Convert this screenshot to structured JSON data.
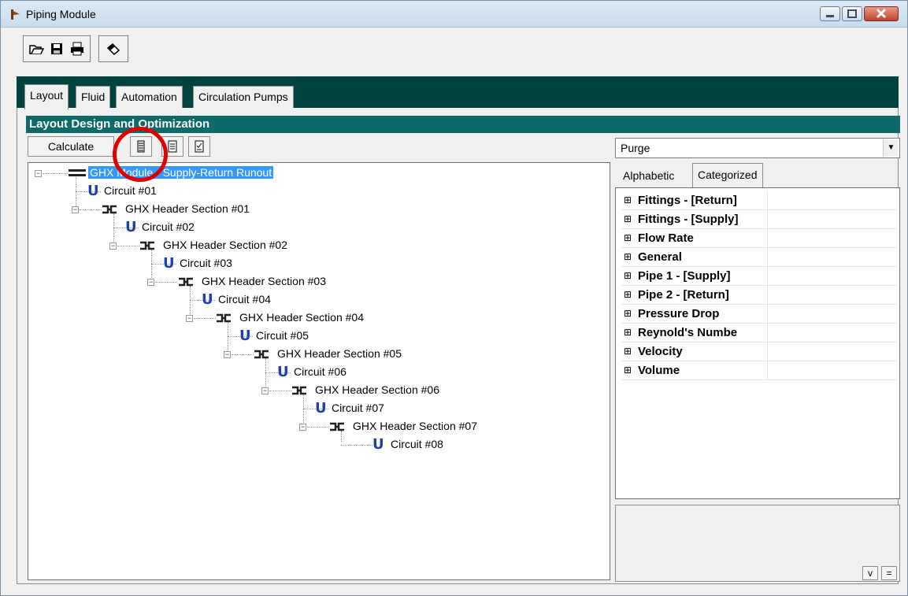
{
  "window": {
    "title": "Piping Module"
  },
  "tabs": [
    "Layout",
    "Fluid",
    "Automation",
    "Circulation Pumps"
  ],
  "section_header": "Layout Design and Optimization",
  "calculate_label": "Calculate",
  "tree": [
    {
      "label": "GHX Module - Supply-Return Runout",
      "icon": "manifold-icon",
      "selected": true
    },
    {
      "label": "Circuit #01",
      "icon": "u-loop-icon"
    },
    {
      "label": "GHX Header Section #01",
      "icon": "header-icon"
    },
    {
      "label": "Circuit #02",
      "icon": "u-loop-icon"
    },
    {
      "label": "GHX Header Section #02",
      "icon": "header-icon"
    },
    {
      "label": "Circuit #03",
      "icon": "u-loop-icon"
    },
    {
      "label": "GHX Header Section #03",
      "icon": "header-icon"
    },
    {
      "label": "Circuit #04",
      "icon": "u-loop-icon"
    },
    {
      "label": "GHX Header Section #04",
      "icon": "header-icon"
    },
    {
      "label": "Circuit #05",
      "icon": "u-loop-icon"
    },
    {
      "label": "GHX Header Section #05",
      "icon": "header-icon"
    },
    {
      "label": "Circuit #06",
      "icon": "u-loop-icon"
    },
    {
      "label": "GHX Header Section #06",
      "icon": "header-icon"
    },
    {
      "label": "Circuit #07",
      "icon": "u-loop-icon"
    },
    {
      "label": "GHX Header Section #07",
      "icon": "header-icon"
    },
    {
      "label": "Circuit #08",
      "icon": "u-loop-icon"
    }
  ],
  "property_combo": {
    "value": "Purge"
  },
  "property_tabs": [
    "Alphabetic",
    "Categorized"
  ],
  "categories": [
    "Fittings - [Return]",
    "Fittings - [Supply]",
    "Flow Rate",
    "General",
    "Pipe 1 - [Supply]",
    "Pipe 2 - [Return]",
    "Pressure Drop",
    "Reynold's Numbe",
    "Velocity",
    "Volume"
  ],
  "desc_buttons": [
    "v",
    "="
  ],
  "colors": {
    "teal_band": "#00433f",
    "section_header": "#0c6b6a",
    "selection": "#3399ff",
    "annotation": "#e00000"
  }
}
